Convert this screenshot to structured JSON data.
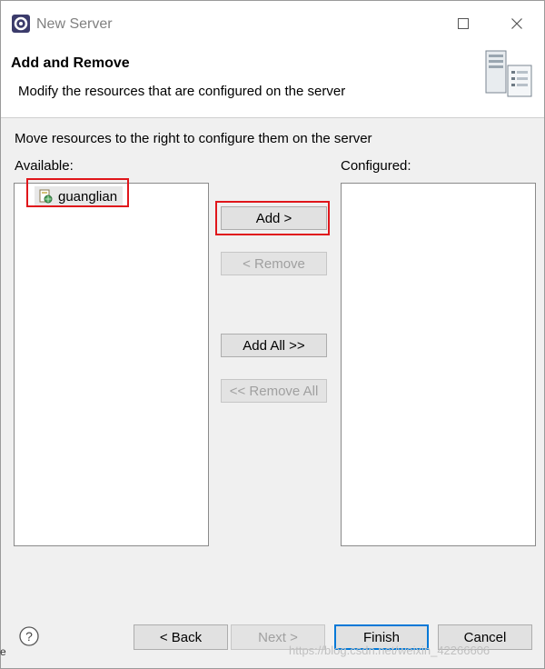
{
  "window": {
    "title": "New Server"
  },
  "header": {
    "title": "Add and Remove",
    "description": "Modify the resources that are configured on the server"
  },
  "main": {
    "instruction": "Move resources to the right to configure them on the server",
    "available_label": "Available:",
    "configured_label": "Configured:",
    "available_items": [
      "guanglian"
    ],
    "configured_items": []
  },
  "actions": {
    "add": "Add >",
    "remove": "< Remove",
    "add_all": "Add All >>",
    "remove_all": "<< Remove All"
  },
  "footer": {
    "back": "< Back",
    "next": "Next >",
    "finish": "Finish",
    "cancel": "Cancel"
  },
  "watermark": "https://blog.csdn.net/weixin_42266606",
  "edge_text": "e",
  "colors": {
    "highlight": "#e0161b",
    "focus": "#0078d7"
  }
}
